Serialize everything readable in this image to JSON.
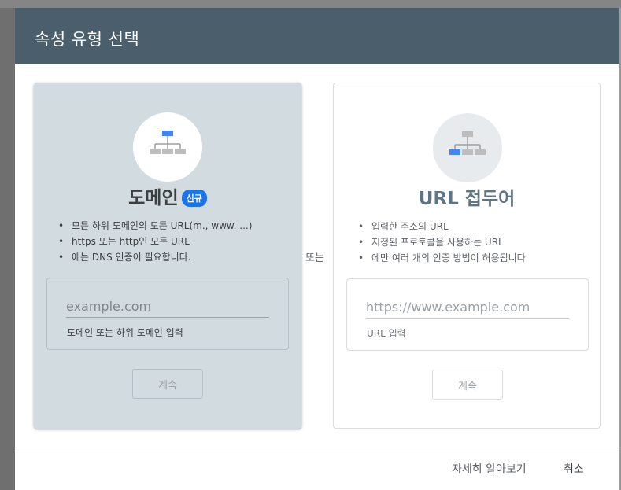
{
  "dialog": {
    "title": "속성 유형 선택",
    "or_label": "또는"
  },
  "domain_card": {
    "title": "도메인",
    "badge": "신규",
    "icon": "sitemap-icon",
    "features": [
      "모든 하위 도메인의 모든 URL(m., www. ...)",
      "https 또는 http인 모든 URL",
      "에는 DNS 인증이 필요합니다."
    ],
    "input_placeholder": "example.com",
    "input_value": "",
    "input_hint": "도메인 또는 하위 도메인 입력",
    "continue_label": "계속"
  },
  "url_card": {
    "title": "URL 접두어",
    "icon": "sitemap-icon",
    "features": [
      "입력한 주소의 URL",
      "지정된 프로토콜을 사용하는 URL",
      "에만 여러 개의 인증 방법이 허용됩니다"
    ],
    "input_placeholder": "https://www.example.com",
    "input_value": "",
    "input_hint": "URL 입력",
    "continue_label": "계속"
  },
  "footer": {
    "learn_more": "자세히 알아보기",
    "cancel": "취소"
  },
  "colors": {
    "header_bg": "#4a5f6b",
    "domain_card_bg": "#d2dbe0",
    "accent_blue": "#1a73e8",
    "url_title": "#5d7584"
  }
}
